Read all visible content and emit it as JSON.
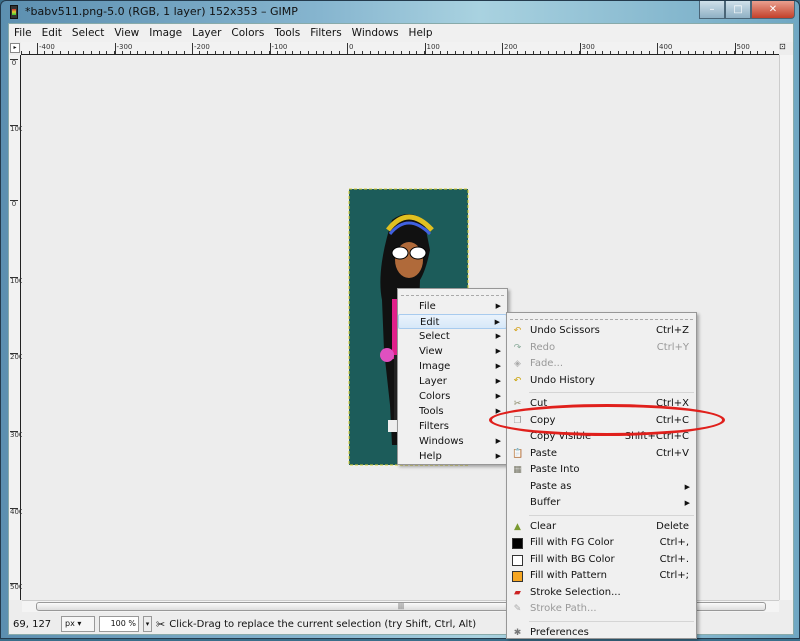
{
  "window": {
    "title": "*babv511.png-5.0 (RGB, 1 layer) 152x353 – GIMP",
    "buttons": [
      "minimize",
      "maximize",
      "close"
    ]
  },
  "menubar": [
    "File",
    "Edit",
    "Select",
    "View",
    "Image",
    "Layer",
    "Colors",
    "Tools",
    "Filters",
    "Windows",
    "Help"
  ],
  "ruler_h": [
    "-400",
    "-300",
    "-200",
    "-100",
    "0",
    "100",
    "200",
    "300",
    "400",
    "500"
  ],
  "ruler_v": [
    "0",
    "100",
    "0",
    "100",
    "200",
    "300",
    "400",
    "500"
  ],
  "image_menu": {
    "items": [
      {
        "label": "File",
        "submenu": true
      },
      {
        "label": "Edit",
        "submenu": true,
        "highlighted": true
      },
      {
        "label": "Select",
        "submenu": true
      },
      {
        "label": "View",
        "submenu": true
      },
      {
        "label": "Image",
        "submenu": true
      },
      {
        "label": "Layer",
        "submenu": true
      },
      {
        "label": "Colors",
        "submenu": true
      },
      {
        "label": "Tools",
        "submenu": true
      },
      {
        "label": "Filters",
        "submenu": false
      },
      {
        "label": "Windows",
        "submenu": true
      },
      {
        "label": "Help",
        "submenu": true
      }
    ]
  },
  "edit_menu": {
    "groups": [
      [
        {
          "label": "Undo Scissors",
          "shortcut": "Ctrl+Z",
          "icon": "undo-icon"
        },
        {
          "label": "Redo",
          "shortcut": "Ctrl+Y",
          "icon": "redo-icon",
          "disabled": true
        },
        {
          "label": "Fade...",
          "shortcut": "",
          "icon": "fade-icon",
          "disabled": true
        },
        {
          "label": "Undo History",
          "shortcut": "",
          "icon": "undo-history-icon"
        }
      ],
      [
        {
          "label": "Cut",
          "shortcut": "Ctrl+X",
          "icon": "cut-icon"
        },
        {
          "label": "Copy",
          "shortcut": "Ctrl+C",
          "icon": "copy-icon"
        },
        {
          "label": "Copy Visible",
          "shortcut": "Shift+Ctrl+C",
          "icon": ""
        },
        {
          "label": "Paste",
          "shortcut": "Ctrl+V",
          "icon": "paste-icon"
        },
        {
          "label": "Paste Into",
          "shortcut": "",
          "icon": "paste-into-icon"
        },
        {
          "label": "Paste as",
          "shortcut": "",
          "submenu": true
        },
        {
          "label": "Buffer",
          "shortcut": "",
          "submenu": true
        }
      ],
      [
        {
          "label": "Clear",
          "shortcut": "Delete",
          "icon": "clear-icon"
        },
        {
          "label": "Fill with FG Color",
          "shortcut": "Ctrl+,",
          "icon": "fg-color-swatch",
          "color": "#000000"
        },
        {
          "label": "Fill with BG Color",
          "shortcut": "Ctrl+.",
          "icon": "bg-color-swatch",
          "color": "#ffffff"
        },
        {
          "label": "Fill with Pattern",
          "shortcut": "Ctrl+;",
          "icon": "pattern-swatch",
          "color": "#f5a623"
        },
        {
          "label": "Stroke Selection...",
          "shortcut": "",
          "icon": "stroke-selection-icon"
        },
        {
          "label": "Stroke Path...",
          "shortcut": "",
          "icon": "stroke-path-icon",
          "disabled": true
        }
      ],
      [
        {
          "label": "Preferences",
          "shortcut": "",
          "icon": "preferences-icon"
        }
      ]
    ]
  },
  "status": {
    "coords": "69, 127",
    "unit": "px",
    "zoom": "100 %",
    "message": "Click-Drag to replace the current selection (try Shift, Ctrl, Alt)"
  },
  "colors": {
    "image_bg": "#1c5c5a",
    "highlight_ellipse": "#e0201c"
  }
}
